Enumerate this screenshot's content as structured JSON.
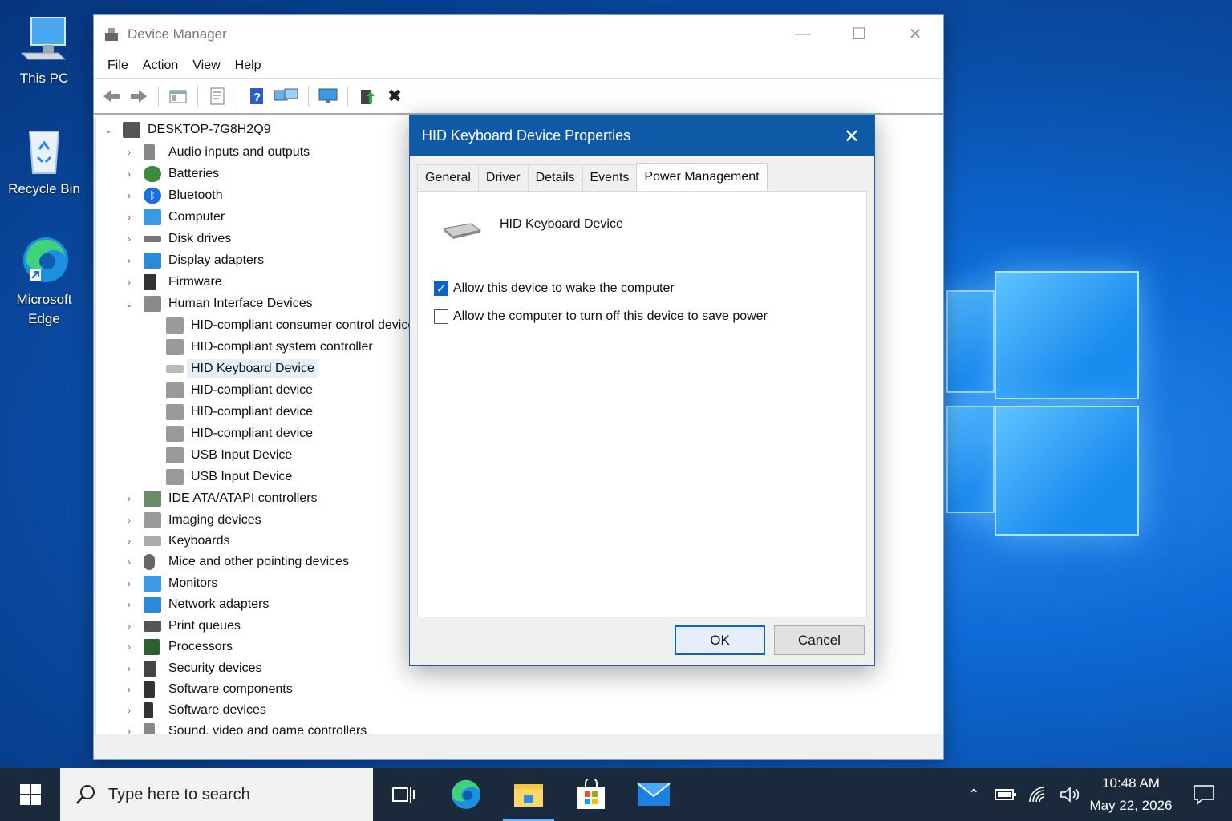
{
  "desktop": {
    "icons": [
      {
        "label": "This PC",
        "icon": "computer-icon"
      },
      {
        "label": "Recycle Bin",
        "icon": "recycle-bin-icon"
      },
      {
        "label": "Microsoft Edge",
        "icon": "edge-icon"
      }
    ]
  },
  "device_manager": {
    "title": "Device Manager",
    "menu": [
      "File",
      "Action",
      "View",
      "Help"
    ],
    "tree": {
      "root": "DESKTOP-7G8H2Q9",
      "categories_top": [
        "Audio inputs and outputs",
        "Batteries",
        "Bluetooth",
        "Computer",
        "Disk drives",
        "Display adapters",
        "Firmware",
        "Human Interface Devices"
      ],
      "hid_children": [
        "HID-compliant consumer control device",
        "HID-compliant system controller",
        "HID Keyboard Device",
        "HID-compliant device",
        "HID-compliant device",
        "HID-compliant device",
        "USB Input Device",
        "USB Input Device"
      ],
      "categories_bottom": [
        "IDE ATA/ATAPI controllers",
        "Imaging devices",
        "Keyboards",
        "Mice and other pointing devices",
        "Monitors",
        "Network adapters",
        "Print queues",
        "Processors",
        "Security devices",
        "Software components",
        "Software devices",
        "Sound, video and game controllers"
      ],
      "selected": "HID Keyboard Device"
    }
  },
  "dialog": {
    "title": "HID Keyboard Device Properties",
    "tabs": [
      "General",
      "Driver",
      "Details",
      "Events",
      "Power Management"
    ],
    "active_tab": "Power Management",
    "device_name": "HID Keyboard Device",
    "options": [
      {
        "label": "Allow this device to wake the computer",
        "checked": true
      },
      {
        "label": "Allow the computer to turn off this device to save power",
        "checked": false
      }
    ],
    "ok_label": "OK",
    "cancel_label": "Cancel"
  },
  "taskbar": {
    "search_placeholder": "Type here to search",
    "time": "10:48 AM",
    "date": "May 22, 2026"
  }
}
